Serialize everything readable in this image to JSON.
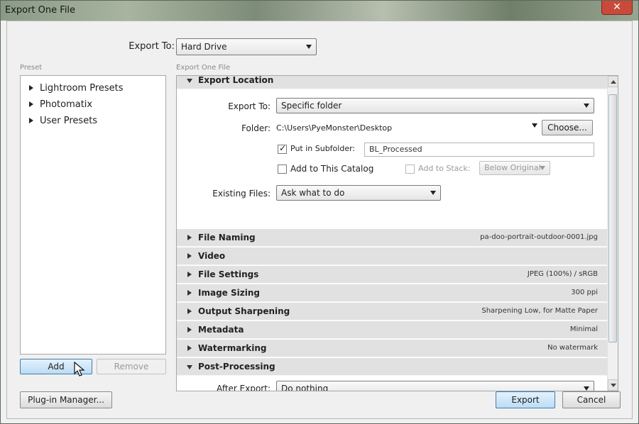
{
  "window": {
    "title": "Export One File",
    "close_glyph": "✕"
  },
  "export_to": {
    "label": "Export To:",
    "value": "Hard Drive"
  },
  "presets": {
    "group_label": "Preset",
    "items": [
      "Lightroom Presets",
      "Photomatix",
      "User Presets"
    ],
    "add_label": "Add",
    "remove_label": "Remove"
  },
  "settings": {
    "group_label": "Export One File",
    "export_location": {
      "title": "Export Location",
      "export_to_label": "Export To:",
      "export_to_value": "Specific folder",
      "folder_label": "Folder:",
      "folder_path": "C:\\Users\\PyeMonster\\Desktop",
      "choose_label": "Choose...",
      "subfolder_label": "Put in Subfolder:",
      "subfolder_value": "BL_Processed",
      "subfolder_checked": true,
      "catalog_label": "Add to This Catalog",
      "catalog_checked": false,
      "stack_label": "Add to Stack:",
      "stack_value": "Below Original",
      "existing_label": "Existing Files:",
      "existing_value": "Ask what to do"
    },
    "sections": [
      {
        "name": "File Naming",
        "summary": "pa-doo-portrait-outdoor-0001.jpg"
      },
      {
        "name": "Video",
        "summary": ""
      },
      {
        "name": "File Settings",
        "summary": "JPEG (100%) / sRGB"
      },
      {
        "name": "Image Sizing",
        "summary": "300 ppi"
      },
      {
        "name": "Output Sharpening",
        "summary": "Sharpening Low, for Matte Paper"
      },
      {
        "name": "Metadata",
        "summary": "Minimal"
      },
      {
        "name": "Watermarking",
        "summary": "No watermark"
      },
      {
        "name": "Post-Processing",
        "summary": ""
      }
    ],
    "post_processing": {
      "after_export_label": "After Export:",
      "after_export_value": "Do nothing"
    }
  },
  "footer": {
    "plugin_manager_label": "Plug-in Manager...",
    "export_label": "Export",
    "cancel_label": "Cancel"
  },
  "icons": {
    "close": "close-icon",
    "dropdown": "chevron-down-icon",
    "expand": "triangle-right-icon",
    "collapse": "triangle-down-icon",
    "cursor": "cursor-icon"
  },
  "colors": {
    "default_button": "#bcdcf4",
    "section_header": "#e1e1e1",
    "close_button": "#c94a3a"
  }
}
